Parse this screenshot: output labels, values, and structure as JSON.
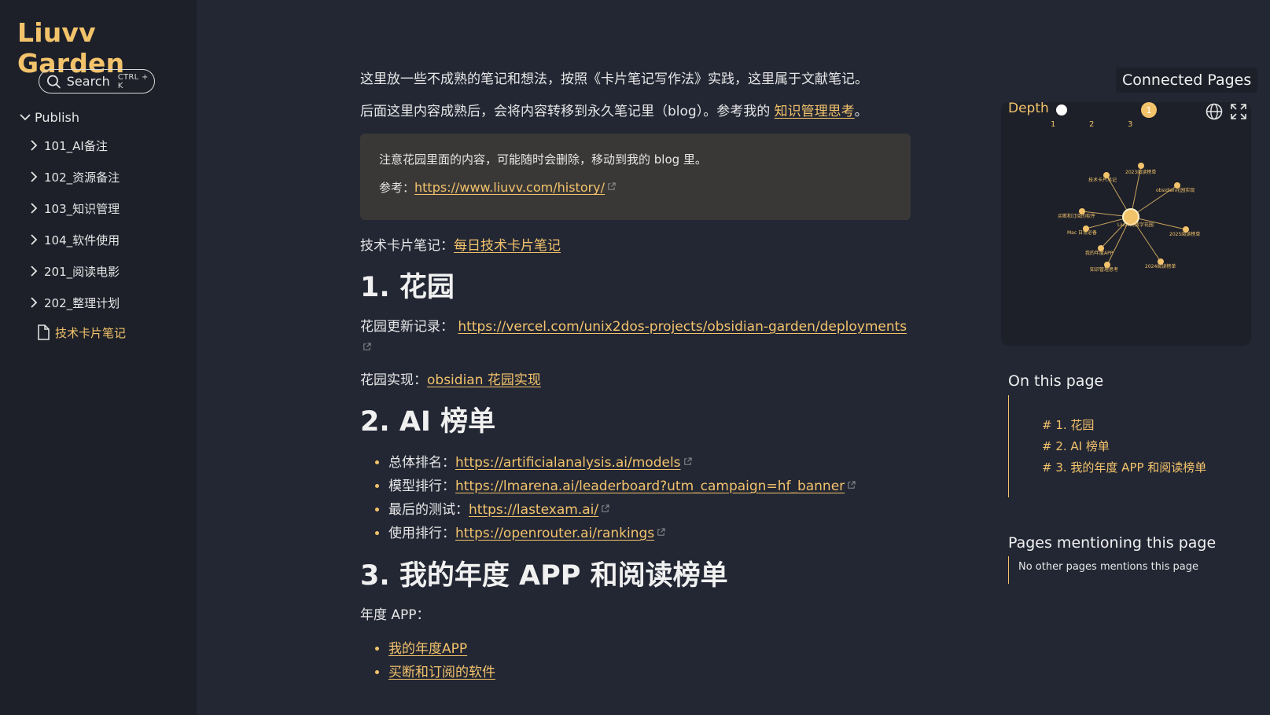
{
  "site": {
    "title": "Liuvv Garden"
  },
  "search": {
    "label": "Search",
    "shortcut": "CTRL + K"
  },
  "explorer": {
    "root": "Publish",
    "folders": [
      "101_AI备注",
      "102_资源备注",
      "103_知识管理",
      "104_软件使用",
      "201_阅读电影",
      "202_整理计划"
    ],
    "file": "技术卡片笔记"
  },
  "content": {
    "intro": "这里放一些不成熟的笔记和想法，按照《卡片笔记写作法》实践，这里属于文献笔记。",
    "intro2_prefix": "后面这里内容成熟后，会将内容转移到永久笔记里（blog）。参考我的 ",
    "intro2_link": "知识管理思考",
    "intro2_suffix": "。",
    "callout_text": "注意花园里面的内容，可能随时会删除，移动到我的 blog 里。",
    "callout_ref_label": "参考：",
    "callout_ref_link": "https://www.liuvv.com/history/",
    "tech_prefix": "技术卡片笔记：",
    "tech_link": "每日技术卡片笔记",
    "h1": "1. 花园",
    "garden_log_label": "花园更新记录：",
    "garden_log_link": "https://vercel.com/unix2dos-projects/obsidian-garden/deployments",
    "garden_impl_label": "花园实现：",
    "garden_impl_link": "obsidian 花园实现",
    "h2": "2. AI 榜单",
    "ai_list": [
      {
        "label": "总体排名：",
        "link": "https://artificialanalysis.ai/models"
      },
      {
        "label": "模型排行：",
        "link": "https://lmarena.ai/leaderboard?utm_campaign=hf_banner"
      },
      {
        "label": "最后的测试：",
        "link": "https://lastexam.ai/"
      },
      {
        "label": "使用排行：",
        "link": "https://openrouter.ai/rankings"
      }
    ],
    "h3": "3. 我的年度 APP 和阅读榜单",
    "annual_label": "年度 APP：",
    "annual_links": [
      "我的年度APP",
      "买断和订阅的软件"
    ]
  },
  "graph": {
    "title": "Connected Pages",
    "depth_label": "Depth",
    "ticks": [
      "1",
      "2",
      "3"
    ],
    "depth_value": "1",
    "nodes": [
      "2023阅读榜单",
      "技术卡片笔记",
      "obsidian花园实现",
      "买断和订阅的软件",
      "Liuvv的数字花园",
      "Mac 日常必备",
      "2025阅读榜单",
      "我的年度APP",
      "2024阅读榜单",
      "知识管理思考"
    ]
  },
  "toc": {
    "title": "On this page",
    "items": [
      "# 1. 花园",
      "# 2. AI 榜单",
      "# 3. 我的年度 APP 和阅读榜单"
    ]
  },
  "mentions": {
    "title": "Pages mentioning this page",
    "empty": "No other pages mentions this page"
  },
  "colors": {
    "accent": "#f3c36b",
    "bg": "#232734",
    "panel": "#1d2029",
    "callout": "#3a3837"
  }
}
